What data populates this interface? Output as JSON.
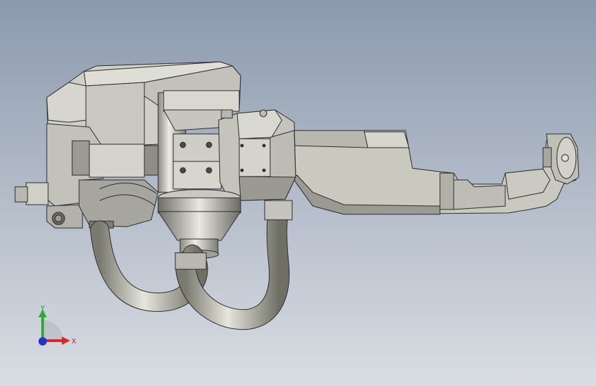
{
  "viewport": {
    "background_top": "#8c9aae",
    "background_bottom": "#d9dde3"
  },
  "model": {
    "part_color_light": "#d4d4cc",
    "part_color_mid": "#b8b8b0",
    "part_color_dark": "#8e8e86",
    "edge_color": "#2a2a28",
    "hose_color": "#c9c9be"
  },
  "triad": {
    "y_label": "Y",
    "x_label": "X",
    "y_color": "#2eaa3a",
    "x_color": "#d02a2a",
    "z_color": "#2233cc"
  }
}
